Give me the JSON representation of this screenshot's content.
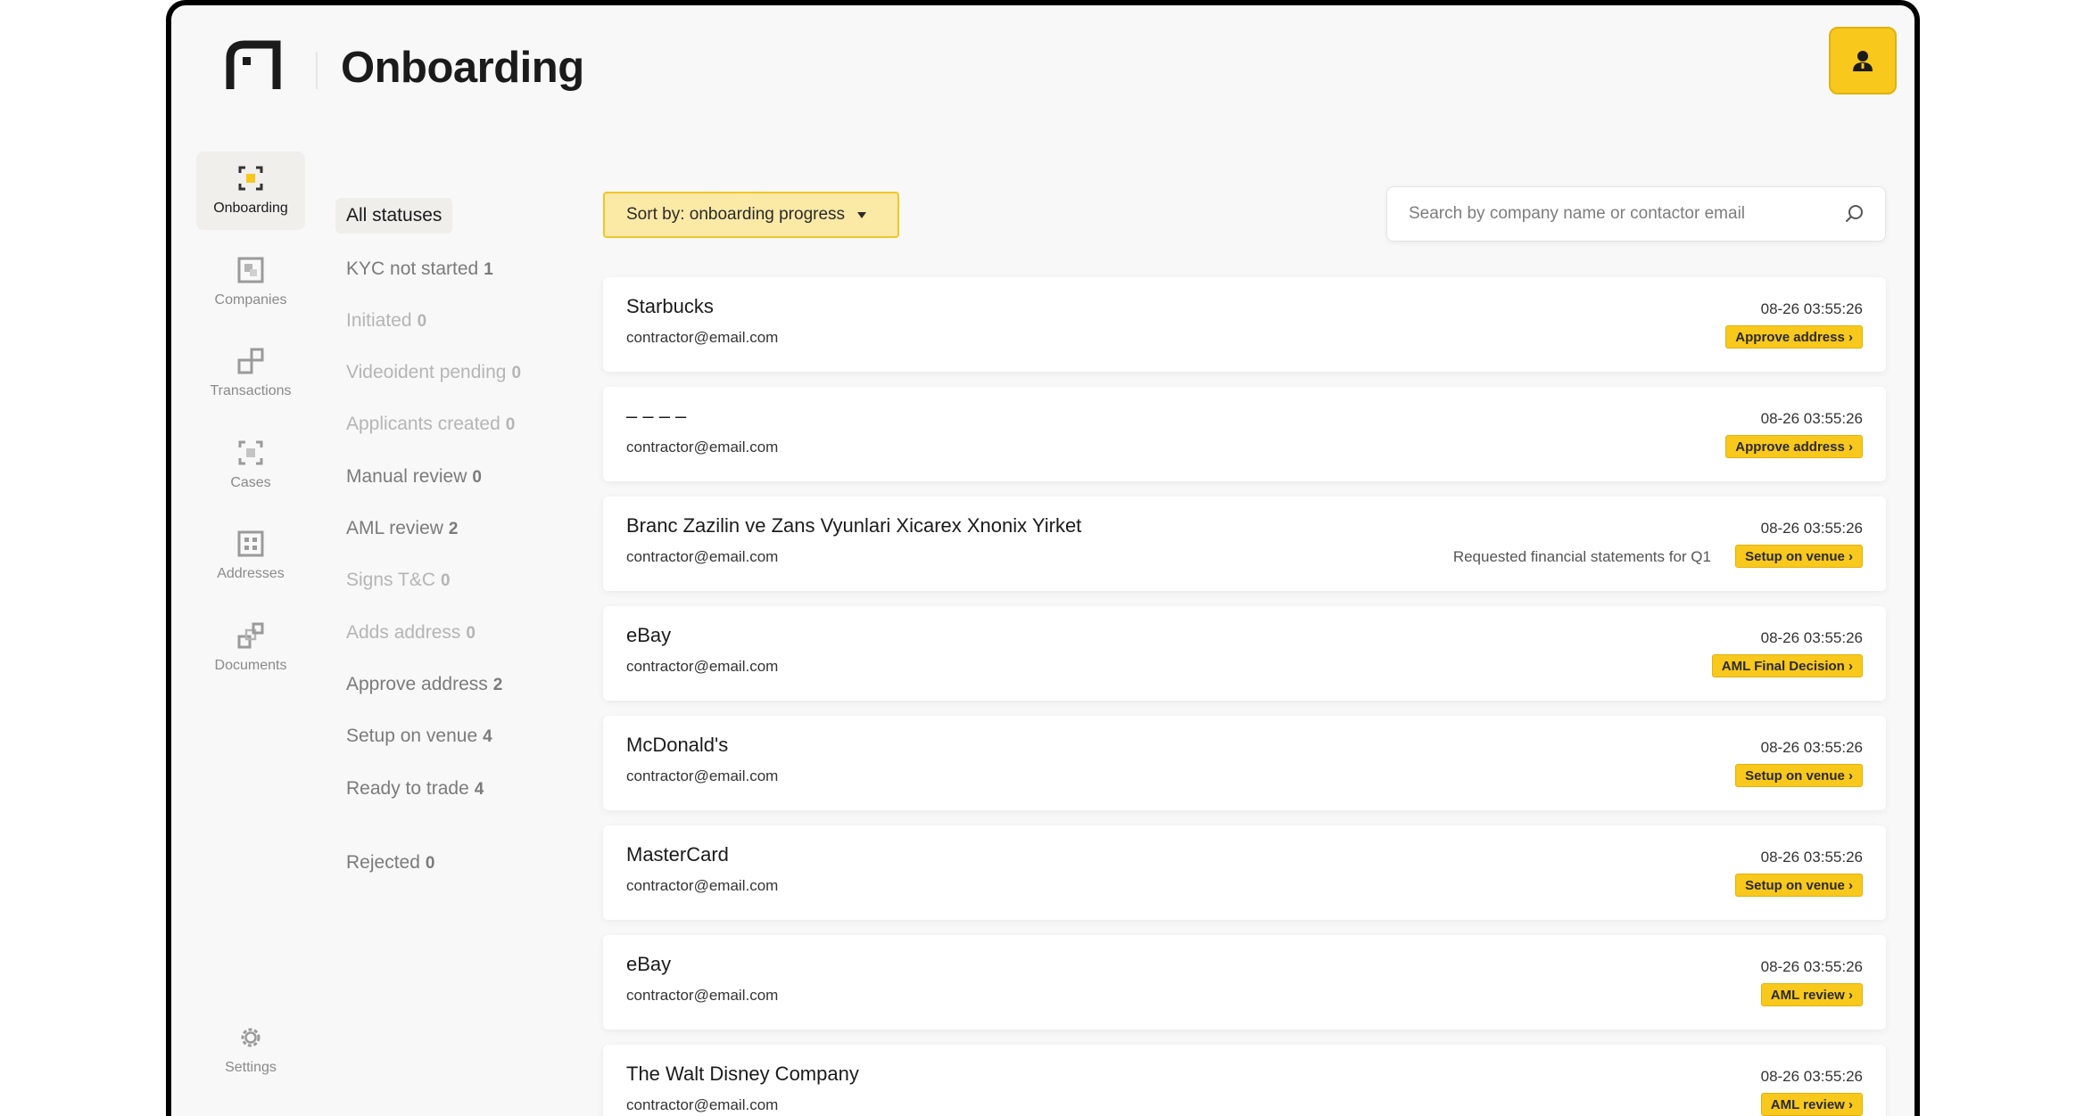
{
  "header": {
    "title": "Onboarding"
  },
  "nav": [
    {
      "label": "Onboarding",
      "icon": "onboarding-icon",
      "active": true
    },
    {
      "label": "Companies",
      "icon": "companies-icon"
    },
    {
      "label": "Transactions",
      "icon": "transactions-icon"
    },
    {
      "label": "Cases",
      "icon": "cases-icon"
    },
    {
      "label": "Addresses",
      "icon": "addresses-icon"
    },
    {
      "label": "Documents",
      "icon": "documents-icon"
    },
    {
      "label": "Settings",
      "icon": "gear-icon"
    }
  ],
  "statuses": [
    {
      "label": "All statuses",
      "count": ""
    },
    {
      "label": "KYC not started",
      "count": "1"
    },
    {
      "label": "Initiated",
      "count": "0"
    },
    {
      "label": "Videoident pending",
      "count": "0"
    },
    {
      "label": "Applicants created",
      "count": "0"
    },
    {
      "label": "Manual review",
      "count": "0"
    },
    {
      "label": "AML review",
      "count": "2"
    },
    {
      "label": "Signs T&C",
      "count": "0"
    },
    {
      "label": "Adds address",
      "count": "0"
    },
    {
      "label": "Approve address",
      "count": "2"
    },
    {
      "label": "Setup on venue",
      "count": "4"
    },
    {
      "label": "Ready to trade",
      "count": "4"
    },
    {
      "label": "Rejected",
      "count": "0"
    }
  ],
  "sort": {
    "label": "Sort by: onboarding progress"
  },
  "search": {
    "placeholder": "Search by company name or contactor email"
  },
  "items": [
    {
      "name": "Starbucks",
      "email": "contractor@email.com",
      "time": "08-26 03:55:26",
      "badge": "Approve address ›",
      "note": ""
    },
    {
      "name": "– – – –",
      "email": "contractor@email.com",
      "time": "08-26 03:55:26",
      "badge": "Approve address ›",
      "note": ""
    },
    {
      "name": "Branc Zazilin ve Zans Vyunlari Xicarex Xnonix Yirket",
      "email": "contractor@email.com",
      "time": "08-26 03:55:26",
      "badge": "Setup on venue ›",
      "note": "Requested financial statements for Q1"
    },
    {
      "name": "eBay",
      "email": "contractor@email.com",
      "time": "08-26 03:55:26",
      "badge": "AML Final Decision ›",
      "note": ""
    },
    {
      "name": "McDonald's",
      "email": "contractor@email.com",
      "time": "08-26 03:55:26",
      "badge": "Setup on venue ›",
      "note": ""
    },
    {
      "name": "MasterCard",
      "email": "contractor@email.com",
      "time": "08-26 03:55:26",
      "badge": "Setup on venue ›",
      "note": ""
    },
    {
      "name": "eBay",
      "email": "contractor@email.com",
      "time": "08-26 03:55:26",
      "badge": "AML review ›",
      "note": ""
    },
    {
      "name": "The Walt Disney Company",
      "email": "contractor@email.com",
      "time": "08-26 03:55:26",
      "badge": "AML review ›",
      "note": ""
    }
  ],
  "colors": {
    "accent": "#f8c81c",
    "background": "#f8f8f8"
  }
}
